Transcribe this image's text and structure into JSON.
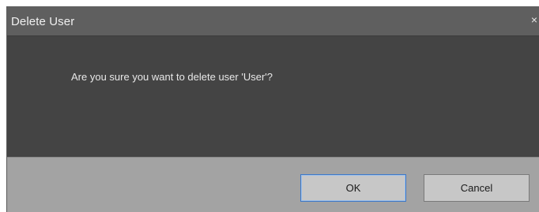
{
  "dialog": {
    "title": "Delete User",
    "close_glyph": "×",
    "message": "Are you sure you want to delete user 'User'?",
    "buttons": {
      "ok_label": "OK",
      "cancel_label": "Cancel"
    }
  },
  "colors": {
    "title_bar": "#5f5f5f",
    "body": "#444444",
    "footer": "#a3a3a3",
    "button": "#c7c7c7",
    "focus_border": "#3f79c7"
  },
  "icons": {
    "close": "close-icon"
  }
}
